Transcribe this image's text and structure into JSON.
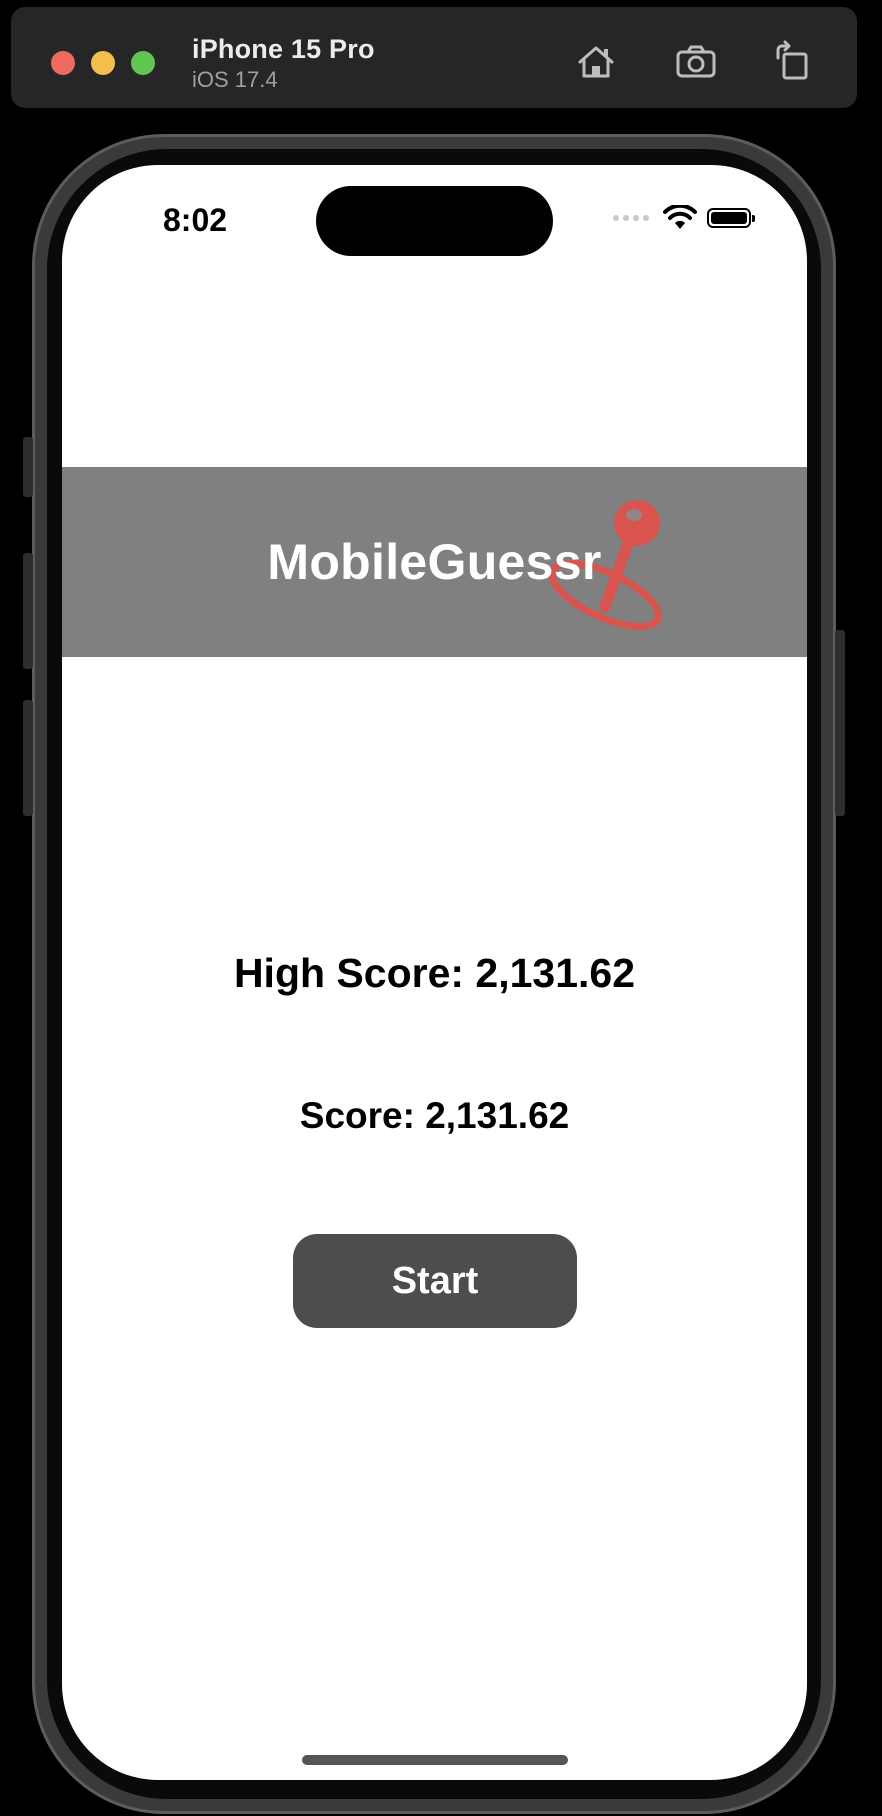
{
  "simulator": {
    "device_name": "iPhone 15 Pro",
    "os_version": "iOS 17.4",
    "toolbar_icons": [
      "home-icon",
      "screenshot-icon",
      "rotate-icon"
    ]
  },
  "status_bar": {
    "time": "8:02",
    "icons": [
      "signal-icon",
      "wifi-icon",
      "battery-icon"
    ]
  },
  "header": {
    "title": "MobileGuessr",
    "background_color": "#808080",
    "logo_icon": "map-pin-icon",
    "logo_color": "#d9534f"
  },
  "main": {
    "high_score_label": "High Score: 2,131.62",
    "score_label": "Score: 2,131.62",
    "start_button_label": "Start",
    "button_color": "#4d4d4d"
  }
}
